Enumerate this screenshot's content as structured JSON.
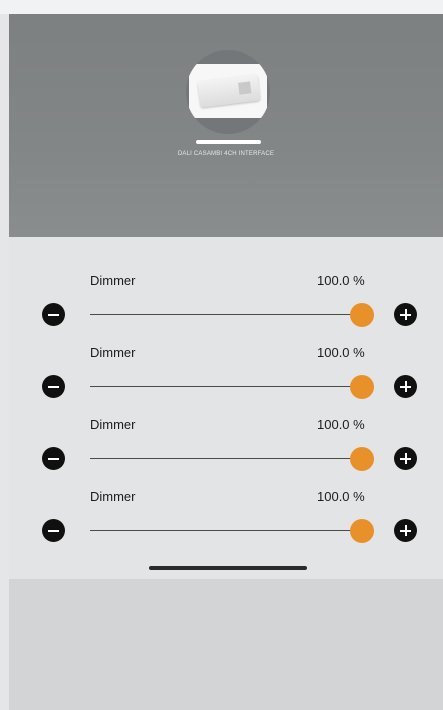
{
  "device": {
    "name": "DALI CASAMBI 4CH INTERFACE",
    "image": "dali-interface-device-photo"
  },
  "colors": {
    "header": "#808384",
    "panel": "#e3e4e5",
    "accent": "#e8912b",
    "button": "#101010"
  },
  "dimmers": [
    {
      "label": "Dimmer",
      "value_text": "100.0 %",
      "level": 100
    },
    {
      "label": "Dimmer",
      "value_text": "100.0 %",
      "level": 100
    },
    {
      "label": "Dimmer",
      "value_text": "100.0 %",
      "level": 100
    },
    {
      "label": "Dimmer",
      "value_text": "100.0 %",
      "level": 100
    }
  ]
}
